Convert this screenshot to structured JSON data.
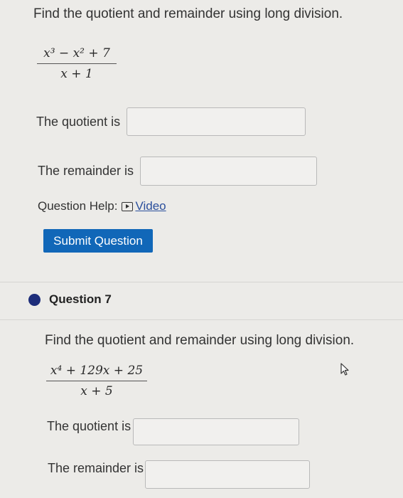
{
  "q6": {
    "intro": "Find the quotient and remainder using long division.",
    "numerator": "x³ − x² + 7",
    "denominator": "x + 1",
    "quotient_label": "The quotient is",
    "quotient_value": "",
    "remainder_label": "The remainder is",
    "remainder_value": "",
    "help_label": "Question Help:",
    "video_label": "Video",
    "submit_label": "Submit Question"
  },
  "q7": {
    "title": "Question 7",
    "intro": "Find the quotient and remainder using long division.",
    "numerator": "x⁴ + 129x + 25",
    "denominator": "x + 5",
    "quotient_label": "The quotient is",
    "quotient_value": "",
    "remainder_label": "The remainder is",
    "remainder_value": ""
  },
  "colors": {
    "accent": "#1167b8",
    "bullet": "#1d2d7a",
    "background": "#ecebe8"
  }
}
